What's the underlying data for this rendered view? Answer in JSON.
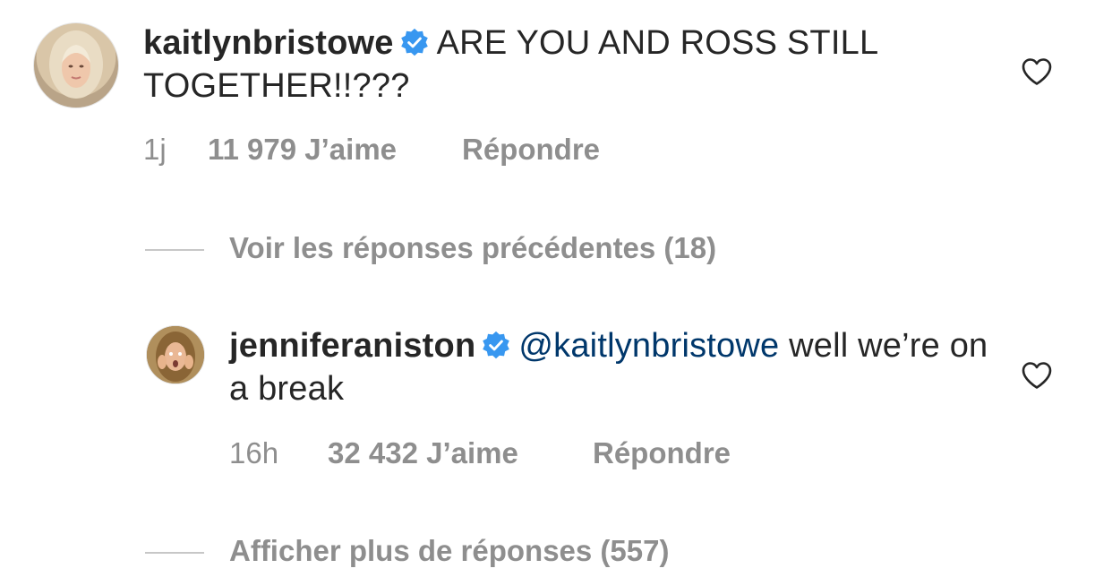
{
  "comments": [
    {
      "username": "kaitlynbristowe",
      "text": "ARE YOU AND ROSS STILL TOGETHER!!???",
      "time": "1j",
      "likes": "11 979 J’aime",
      "reply": "Répondre"
    },
    {
      "username": "jenniferaniston",
      "mention": "@kaitlynbristowe",
      "text": "well we’re on a break",
      "time": "16h",
      "likes": "32 432 J’aime",
      "reply": "Répondre"
    }
  ],
  "view_previous_replies": "Voir les réponses précédentes (18)",
  "show_more_replies": "Afficher plus de réponses (557)",
  "colors": {
    "text": "#262626",
    "secondary": "#8e8e8e",
    "verified": "#3897f0",
    "mention": "#00376b"
  },
  "icons": {
    "verified": "verified-badge-icon",
    "like": "heart-outline-icon"
  }
}
